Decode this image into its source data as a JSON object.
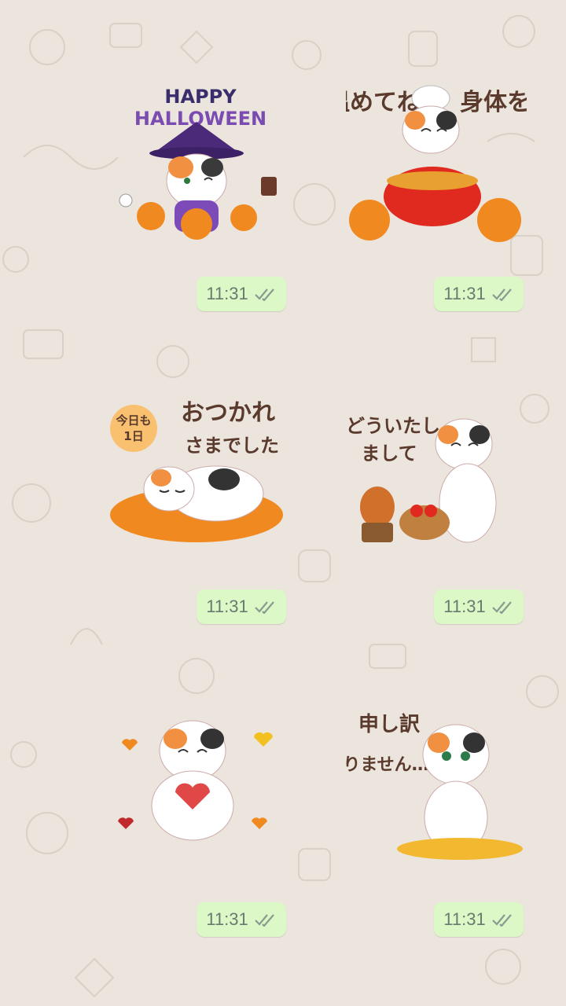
{
  "theme": {
    "wallpaper": "#ece5dd",
    "bubble": "#dcf8c6",
    "read_tick": "#8a9a90"
  },
  "messages": [
    {
      "sticker": "halloween-cat",
      "texts": [
        "HAPPY",
        "HALLOWEEN"
      ],
      "time": "11:31",
      "status": "read"
    },
    {
      "sticker": "chef-cat",
      "texts": [
        "身体を",
        "温めてね"
      ],
      "time": "11:31",
      "status": "read"
    },
    {
      "sticker": "tired-cat",
      "texts": [
        "今日も",
        "1日",
        "おつかれ",
        "さまでした"
      ],
      "time": "11:31",
      "status": "read"
    },
    {
      "sticker": "welcome-cat",
      "texts": [
        "どういたし",
        "まして"
      ],
      "time": "11:31",
      "status": "read"
    },
    {
      "sticker": "heart-cat",
      "texts": [],
      "time": "11:31",
      "status": "read"
    },
    {
      "sticker": "sorry-cat",
      "texts": [
        "申し訳",
        "ありません…"
      ],
      "time": "11:31",
      "status": "read"
    }
  ]
}
